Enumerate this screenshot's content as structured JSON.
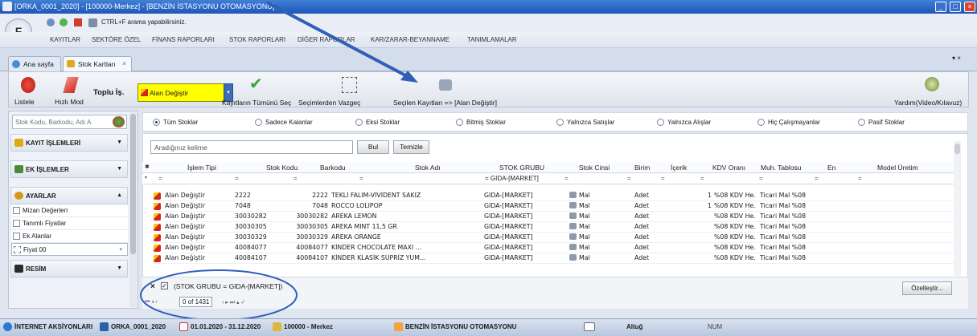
{
  "window": {
    "title": "[ORKA_0001_2020]  -  [100000-Merkez]  -  [BENZİN İSTASYONU OTOMASYONU]"
  },
  "qat": {
    "search_hint": "CTRL+F arama yapabilirsiniz."
  },
  "menu": [
    "KAYITLAR",
    "SEKTÖRE ÖZEL",
    "FİNANS RAPORLARI",
    "STOK RAPORLARI",
    "DİĞER RAPORLAR",
    "KAR/ZARAR-BEYANNAME",
    "TANIMLAMALAR"
  ],
  "tabs": [
    {
      "label": "Ana sayfa"
    },
    {
      "label": "Stok Kartları"
    }
  ],
  "toolbar": {
    "list": "Listele",
    "fast_mode": "Hızlı Mod",
    "bulk_label": "Toplu İş.",
    "bulk_value": "Alan Değiştir",
    "select_all": "Kayıtların Tümünü Seç",
    "deselect": "Seçimlerden Vazgeç",
    "apply": "Seçilen Kayıtları => [Alan Değiştir]",
    "help": "Yardım(Video/Kılavuz)"
  },
  "sidebar": {
    "search_placeholder": "Stok Kodu, Barkodu, Adı A",
    "sections": [
      "KAYIT İŞLEMLERİ",
      "EK İŞLEMLER",
      "AYARLAR",
      "RESİM"
    ],
    "settings_items": [
      "Mizan Değerleri",
      "Tanımlı Fiyatlar",
      "Ek Alanlar",
      "Fiyat 00"
    ]
  },
  "filters": {
    "options": [
      "Tüm Stoklar",
      "Sadece Kalanlar",
      "Eksi Stoklar",
      "Bitmiş Stoklar",
      "Yalnızca Satışlar",
      "Yalnızca Alışlar",
      "Hiç Çalışmayanlar",
      "Pasif Stoklar"
    ],
    "selected": "Tüm Stoklar"
  },
  "grid": {
    "search_placeholder": "Aradığınız kelime",
    "search_button": "Bul",
    "clear_button": "Temizle",
    "columns": [
      "İşlem Tipi",
      "Stok Kodu",
      "Barkodu",
      "Stok Adı",
      "STOK GRUBU",
      "Stok Cinsi",
      "Birim",
      "İçerik",
      "KDV Oranı",
      "Muh. Tablosu",
      "En",
      "Model Üretim"
    ],
    "filter_cells": [
      "=",
      "=",
      "=",
      "=",
      "= GIDA-[MARKET]",
      "=",
      "=",
      "=",
      "=",
      "=",
      "=",
      "="
    ],
    "rows": [
      [
        "Alan Değiştir",
        "2222",
        "2222",
        "TEKLİ FALIM-VİVİDENT SAKIZ",
        "GIDA-[MARKET]",
        "Mal",
        "Adet",
        "1",
        "%08 KDV He...",
        "Ticari Mal %08"
      ],
      [
        "Alan Değiştir",
        "7048",
        "7048",
        "ROCCO LOLIPOP",
        "GIDA-[MARKET]",
        "Mal",
        "Adet",
        "1",
        "%08 KDV He...",
        "Ticari Mal %08"
      ],
      [
        "Alan Değiştir",
        "30030282",
        "30030282",
        "AREKA LEMON",
        "GIDA-[MARKET]",
        "Mal",
        "Adet",
        "",
        "%08 KDV He...",
        "Ticari Mal %08"
      ],
      [
        "Alan Değiştir",
        "30030305",
        "30030305",
        "AREKA MINT 11,5 GR",
        "GIDA-[MARKET]",
        "Mal",
        "Adet",
        "",
        "%08 KDV He...",
        "Ticari Mal %08"
      ],
      [
        "Alan Değiştir",
        "30030329",
        "30030329",
        "AREKA ORANGE",
        "GIDA-[MARKET]",
        "Mal",
        "Adet",
        "",
        "%08 KDV He...",
        "Ticari Mal %08"
      ],
      [
        "Alan Değiştir",
        "40084077",
        "40084077",
        "KİNDER CHOCOLATE MAXI ...",
        "GIDA-[MARKET]",
        "Mal",
        "Adet",
        "",
        "%08 KDV He...",
        "Ticari Mal %08"
      ],
      [
        "Alan Değiştir",
        "40084107",
        "40084107",
        "KİNDER KLASİK SÜPRİZ YUM...",
        "GIDA-[MARKET]",
        "Mal",
        "Adet",
        "",
        "%08 KDV He...",
        "Ticari Mal %08"
      ]
    ],
    "filter_text": "(STOK GRUBU = GIDA-[MARKET])",
    "pager": "0 of 1431",
    "customize": "Özelleştir..."
  },
  "status": {
    "aksiyon": "İNTERNET AKSİYONLARI",
    "company": "ORKA_0001_2020",
    "period": "01.01.2020 - 31.12.2020",
    "branch": "100000 - Merkez",
    "module": "BENZİN İSTASYONU OTOMASYONU",
    "user": "Altuğ",
    "num": "NUM"
  },
  "colors": {
    "title": "#1e56b8",
    "annotation": "#2f5fb8",
    "bulk": "#ffff00"
  }
}
